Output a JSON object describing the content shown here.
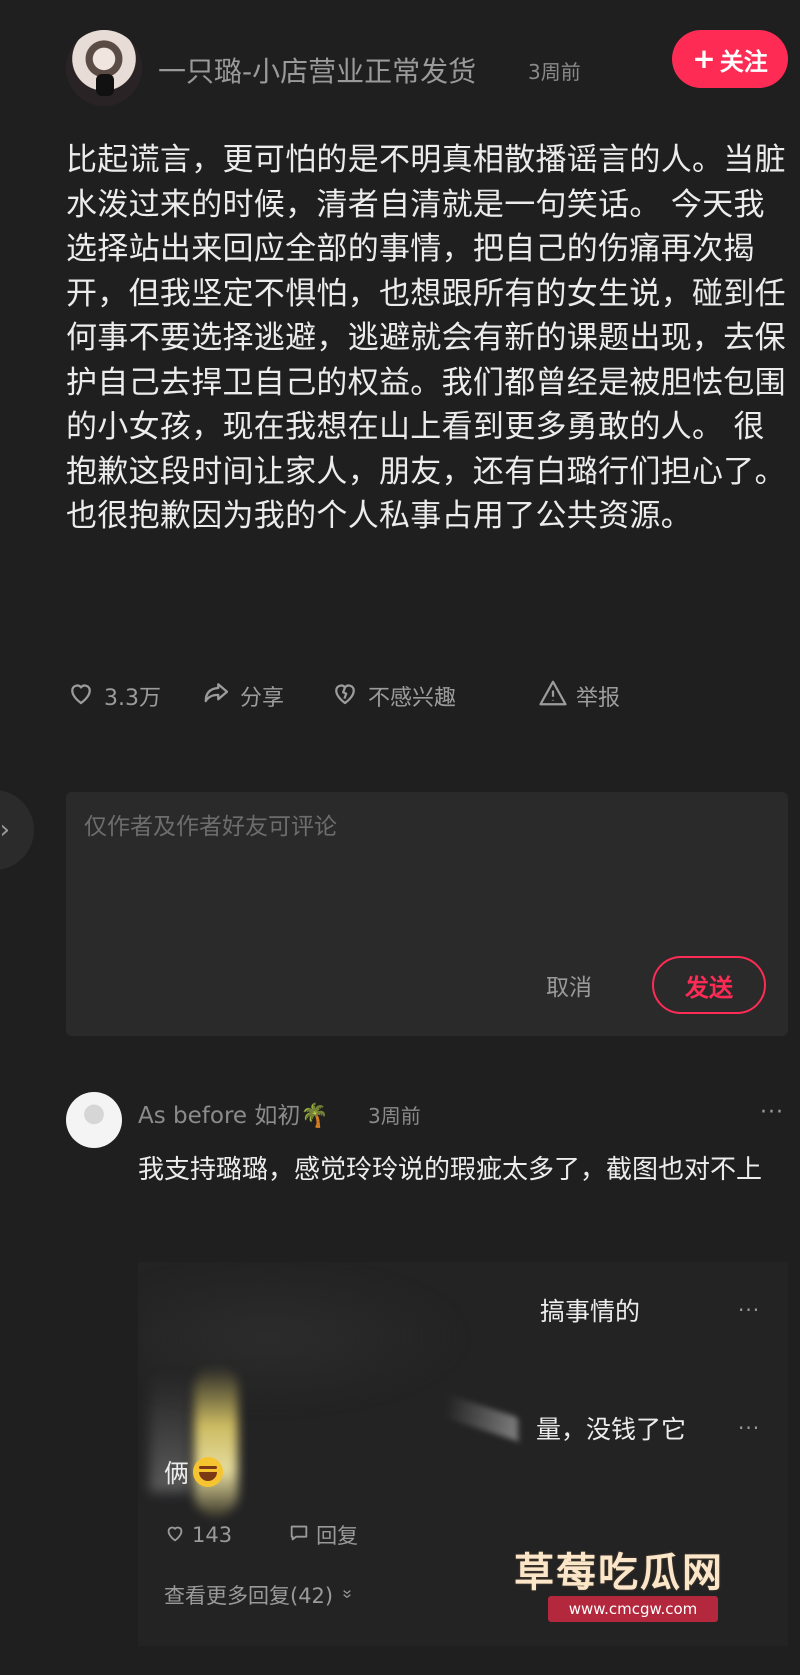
{
  "post": {
    "author": "一只璐-小店营业正常发货",
    "time": "3周前",
    "follow_label": "关注",
    "text": "比起谎言，更可怕的是不明真相散播谣言的人。当脏水泼过来的时候，清者自清就是一句笑话。 今天我选择站出来回应全部的事情，把自己的伤痛再次揭开，但我坚定不惧怕，也想跟所有的女生说，碰到任何事不要选择逃避，逃避就会有新的课题出现，去保护自己去捍卫自己的权益。我们都曾经是被胆怯包围的小女孩，现在我想在山上看到更多勇敢的人。 很抱歉这段时间让家人，朋友，还有白璐行们担心了。也很抱歉因为我的个人私事占用了公共资源。",
    "actions": {
      "likes": "3.3万",
      "share": "分享",
      "not_interested": "不感兴趣",
      "report": "举报"
    }
  },
  "comment_box": {
    "placeholder": "仅作者及作者好友可评论",
    "cancel_label": "取消",
    "send_label": "发送"
  },
  "comment": {
    "author": "As before 如初🌴",
    "time": "3周前",
    "more": "···",
    "text": "我支持璐璐，感觉玲玲说的瑕疵太多了，截图也对不上"
  },
  "embedded_screenshot": {
    "line1": "搞事情的",
    "line2": "量，没钱了它",
    "line3": "俩",
    "dots": "···",
    "likes": "143",
    "reply_label": "回复",
    "more_replies": "查看更多回复(42)"
  },
  "watermark": {
    "title": "草莓吃瓜网",
    "url": "www.cmcgw.com"
  },
  "colors": {
    "background": "#1f1f20",
    "accent": "#fe2c55",
    "panel": "#2a2a2b"
  }
}
